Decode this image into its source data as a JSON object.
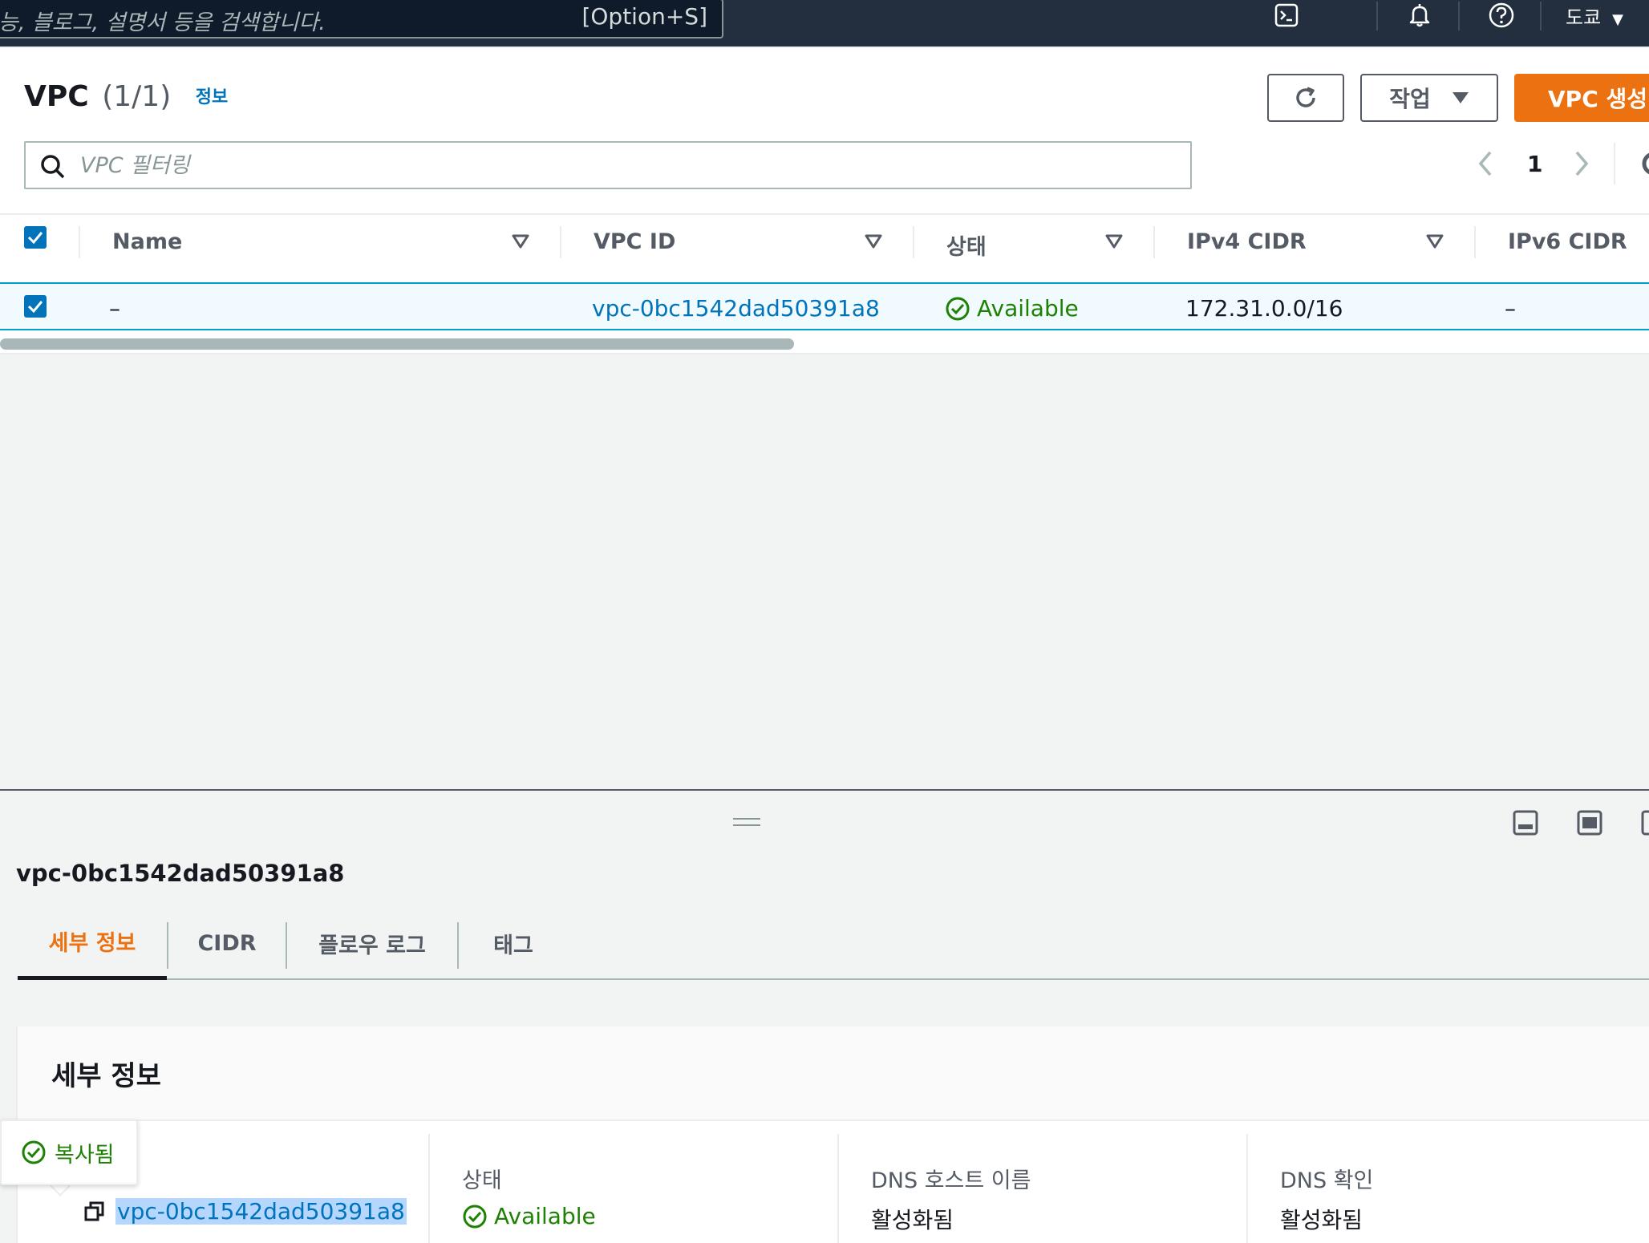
{
  "topnav": {
    "search_placeholder": "능, 블로그, 설명서 등을 검색합니다.",
    "search_shortcut": "[Option+S]",
    "icons": [
      "cloudshell-icon",
      "bell-icon",
      "help-icon"
    ],
    "region": "도쿄",
    "region_caret": "▼"
  },
  "vpc_panel": {
    "title": "VPC",
    "count": "(1/1)",
    "info_link": "정보",
    "actions_label": "작업",
    "create_label": "VPC 생성",
    "filter_placeholder": "VPC 필터링",
    "page": "1",
    "columns": [
      "Name",
      "VPC ID",
      "상태",
      "IPv4 CIDR",
      "IPv6 CIDR"
    ],
    "rows": [
      {
        "name": "–",
        "vpc_id": "vpc-0bc1542dad50391a8",
        "status": "Available",
        "ipv4_cidr": "172.31.0.0/16",
        "ipv6_cidr": "–"
      }
    ]
  },
  "split_panel": {
    "title": "vpc-0bc1542dad50391a8",
    "tabs": [
      "세부 정보",
      "CIDR",
      "플로우 로그",
      "태그"
    ],
    "details_title": "세부 정보",
    "copied_toast": "복사됨",
    "fields": {
      "vpc_id_value": "vpc-0bc1542dad50391a8",
      "status_label": "상태",
      "status_value": "Available",
      "dns_hostnames_label": "DNS 호스트 이름",
      "dns_hostnames_value": "활성화됨",
      "dns_resolution_label": "DNS 확인",
      "dns_resolution_value": "활성화됨"
    }
  },
  "colors": {
    "nav_bg": "#232f3e",
    "primary_orange": "#ec7211",
    "link_blue": "#0073bb",
    "success_green": "#1d8102",
    "selected_row_bg": "#f1faff"
  }
}
